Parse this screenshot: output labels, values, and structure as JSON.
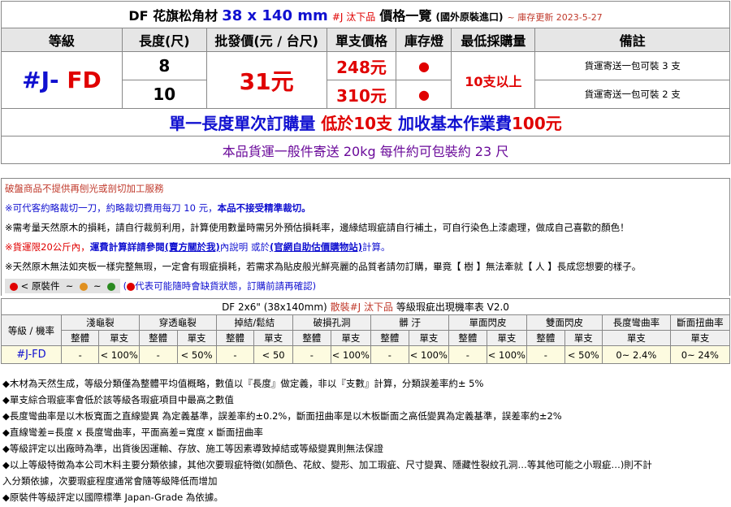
{
  "title": {
    "brand": "DF 花旗松角材",
    "size": "38 x 140 mm",
    "tag": "#J 汰下品",
    "price_list": "價格一覽",
    "origin": "(國外原裝進口)",
    "update": "~ 庫存更新 2023-5-27"
  },
  "headers": [
    "等級",
    "長度(尺)",
    "批發價(元 / 台尺)",
    "單支價格",
    "庫存燈",
    "最低採購量",
    "備註"
  ],
  "product": {
    "grade_prefix": "#J-",
    "grade_suffix": " FD",
    "wholesale": "31元",
    "min_order": "10支以上",
    "rows": [
      {
        "length": "8",
        "price": "248元",
        "stock": "●",
        "note": "貨運寄送一包可裝 3 支"
      },
      {
        "length": "10",
        "price": "310元",
        "stock": "●",
        "note": "貨運寄送一包可裝 2 支"
      }
    ]
  },
  "banner1": {
    "a": "單一長度單次訂購量",
    "b": "低於10支",
    "c": "加收基本作業費",
    "d": "100元"
  },
  "banner2": "本品貨運一般件寄送 20kg 每件約可包裝約 23 尺",
  "notes": {
    "n1": "破盤商品不提供再刨光或剖切加工服務",
    "n2": "※可代客約略裁切一刀，約略裁切費用每刀 10 元，",
    "n2b": "本品不接受精準裁切。",
    "n3": "※需考量天然原木的損耗，請自行裁剪利用，計算使用數量時需另外預估損耗率，邊緣結瑕疵請自行補土，可自行染色上漆處理，做成自己喜歡的顏色！",
    "n4a": "※貨運限20公斤內，",
    "n4b": "運費計算詳請參閱",
    "n4c": "(賣方關於我)",
    "n4d": "內說明 或於",
    "n4e": "(官網自助估價購物站)",
    "n4f": "計算。",
    "n5": "※天然原木無法如夾板一樣完整無瑕，一定會有瑕疵損耗，若需求為貼皮般光鮮亮麗的品質者請勿訂購，畢竟【 樹 】無法牽就【 人 】長成您想要的樣子。",
    "legend_label": "< 原裝件",
    "legend_sep": "~",
    "legend_note": "代表可能隨時會缺貨狀態，訂購前請再確認)",
    "legend_open": "("
  },
  "defects": {
    "title_a": "DF 2x6\" (38x140mm)",
    "title_b": "散裝#J 汰下品",
    "title_c": "等級瑕疵出現機率表 V2.0",
    "grade_header": "等級 / 機率",
    "categories": [
      "淺龜裂",
      "穿透龜裂",
      "掉結/鬆結",
      "破損孔洞",
      "髒 汙",
      "單面閃皮",
      "雙面閃皮",
      "長度彎曲率",
      "斷面扭曲率"
    ],
    "sub_whole": "整體",
    "sub_single": "單支",
    "single_only": "單支",
    "grade": "#J-FD",
    "values": [
      "-",
      "< 100%",
      "-",
      "< 50%",
      "-",
      "< 50",
      "-",
      "< 100%",
      "-",
      "< 100%",
      "-",
      "< 100%",
      "-",
      "< 50%",
      "0~ 2.4%",
      "0~ 24%"
    ]
  },
  "bottom_notes": [
    "◆木材為天然生成，等級分類僅為整體平均值概略，數值以『長度』做定義，非以『支數』計算，分類誤差率約± 5%",
    "◆單支綜合瑕疵率會低於該等級各瑕疵項目中最高之數值",
    "◆長度彎曲率是以木板寬面之直線變異 為定義基準，誤差率約±0.2%，斷面扭曲率是以木板斷面之高低變異為定義基準，誤差率約±2%",
    "◆直線彎差=長度 x 長度彎曲率，平面高差=寬度 x 斷面扭曲率",
    "◆等級評定以出廠時為準，出貨後因運輸、存放、施工等因素導致掉結或等級變異則無法保證",
    "◆以上等級特徵為本公司木料主要分類依據，其他次要瑕疵特徵(如顏色、花紋、變形、加工瑕疵、尺寸變異、隱藏性裂紋孔洞…等其他可能之小瑕疵…)則不計",
    "入分類依據，次要瑕疵程度通常會隨等級降低而增加",
    "◆原裝件等級評定以國際標準 Japan-Grade 為依據。"
  ],
  "colors": {
    "red": "#e00000",
    "blue": "#1010d0",
    "purple": "#6a0a9a",
    "green": "#2a8a20",
    "orange": "#e09020"
  }
}
